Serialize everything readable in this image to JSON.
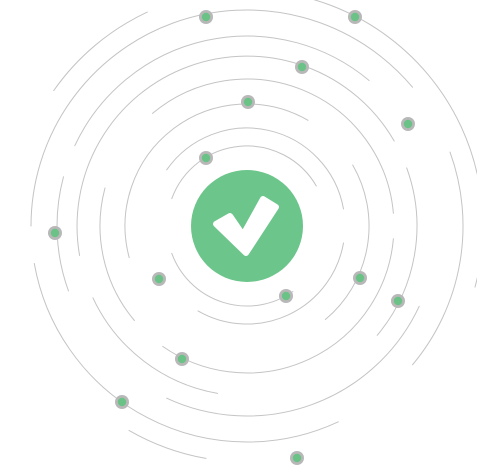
{
  "icon": "check-circle-icon",
  "colors": {
    "background": "#ffffff",
    "orbit_line": "#c4c4c4",
    "node_fill": "#6ac287",
    "node_ring": "#b8b8b8",
    "badge_fill": "#6cc58a",
    "check_mark": "#ffffff"
  }
}
